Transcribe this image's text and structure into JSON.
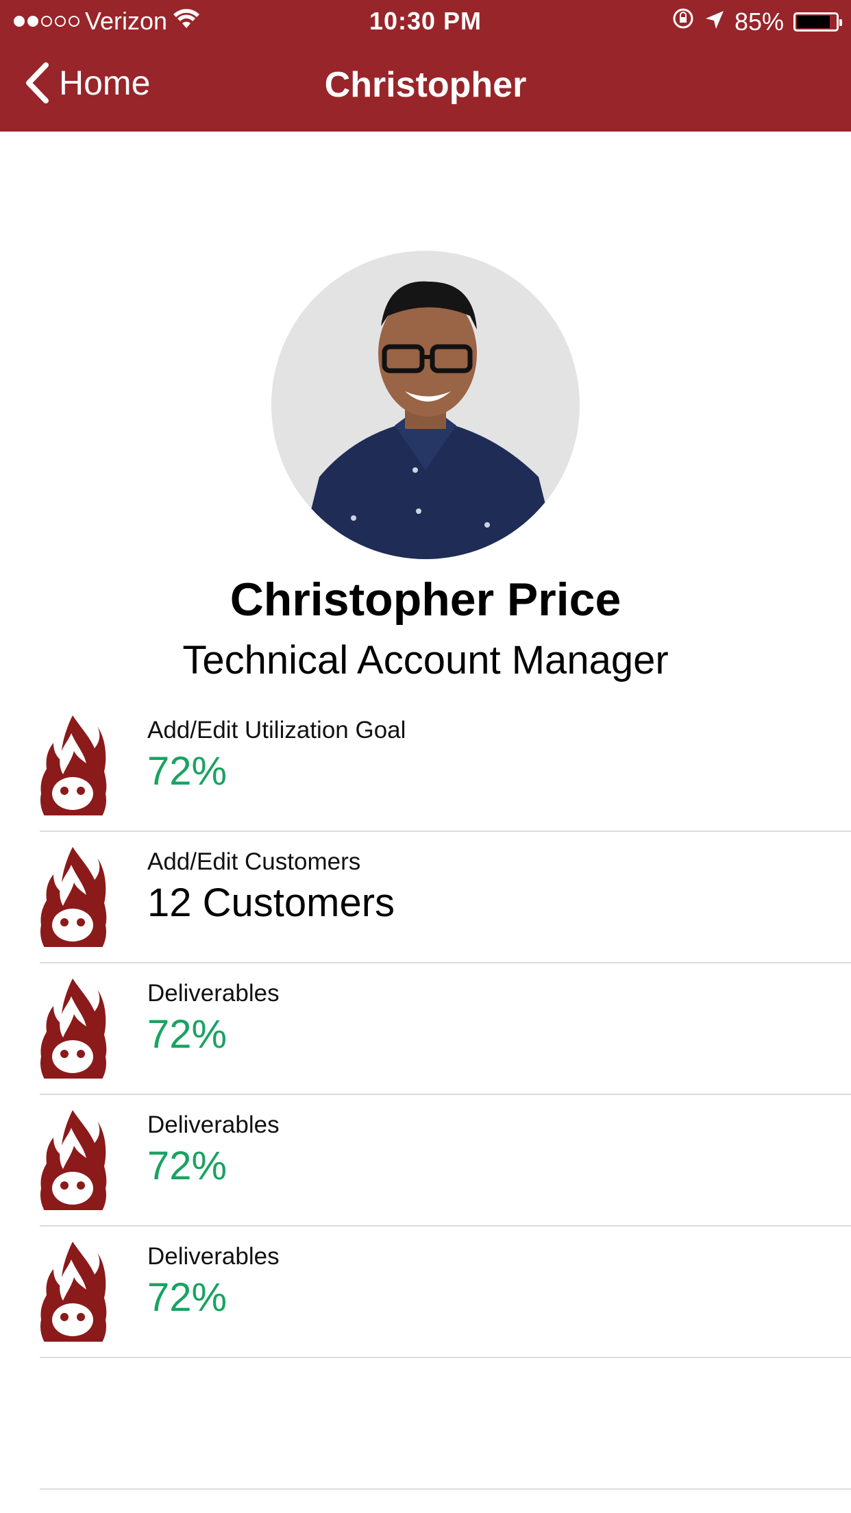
{
  "status_bar": {
    "carrier": "Verizon",
    "time": "10:30 PM",
    "battery": "85%",
    "battery_level": 0.85
  },
  "nav": {
    "back_label": "Home",
    "title": "Christopher"
  },
  "profile": {
    "name": "Christopher Price",
    "role": "Technical Account Manager"
  },
  "items": [
    {
      "label": "Add/Edit Utilization Goal",
      "value": "72%",
      "icon": "flame-logo-icon",
      "value_color": "#1aa262"
    },
    {
      "label": "Add/Edit Customers",
      "value": "12 Customers",
      "icon": "flame-logo-icon",
      "value_color": "#000000"
    },
    {
      "label": "Deliverables",
      "value": "72%",
      "icon": "flame-logo-icon",
      "value_color": "#1aa262"
    },
    {
      "label": "Deliverables",
      "value": "72%",
      "icon": "flame-logo-icon",
      "value_color": "#1aa262"
    },
    {
      "label": "Deliverables",
      "value": "72%",
      "icon": "flame-logo-icon",
      "value_color": "#1aa262"
    }
  ],
  "colors": {
    "brand": "#98252a",
    "icon": "#8b1a1a",
    "positive": "#1aa262"
  }
}
